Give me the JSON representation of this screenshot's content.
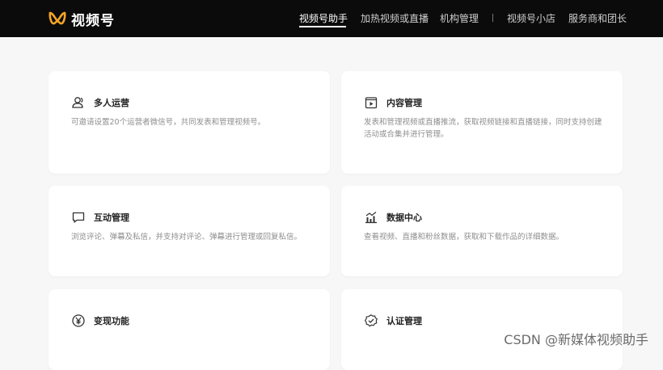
{
  "header": {
    "logo_text": "视频号",
    "nav": [
      {
        "label": "视频号助手",
        "active": true
      },
      {
        "label": "加热视频或直播",
        "active": false
      },
      {
        "label": "机构管理",
        "active": false
      },
      {
        "label": "视频号小店",
        "active": false
      },
      {
        "label": "服务商和团长",
        "active": false
      }
    ]
  },
  "colors": {
    "logo_accent": "#f5a524",
    "header_bg": "#0b0b0b",
    "page_bg": "#f7f7f7"
  },
  "cards": [
    {
      "icon": "users-icon",
      "title": "多人运营",
      "desc": "可邀请设置20个运营者微信号，共同发表和管理视频号。"
    },
    {
      "icon": "play-square-icon",
      "title": "内容管理",
      "desc": "发表和管理视频或直播推流，获取视频链接和直播链接，同时支持创建活动或合集并进行管理。"
    },
    {
      "icon": "comment-icon",
      "title": "互动管理",
      "desc": "浏览评论、弹幕及私信，并支持对评论、弹幕进行管理或回复私信。"
    },
    {
      "icon": "chart-icon",
      "title": "数据中心",
      "desc": "查看视频、直播和粉丝数据，获取和下载作品的详细数据。"
    },
    {
      "icon": "yen-icon",
      "title": "变现功能",
      "desc": ""
    },
    {
      "icon": "verified-icon",
      "title": "认证管理",
      "desc": ""
    }
  ],
  "watermark": "CSDN @新媒体视频助手"
}
